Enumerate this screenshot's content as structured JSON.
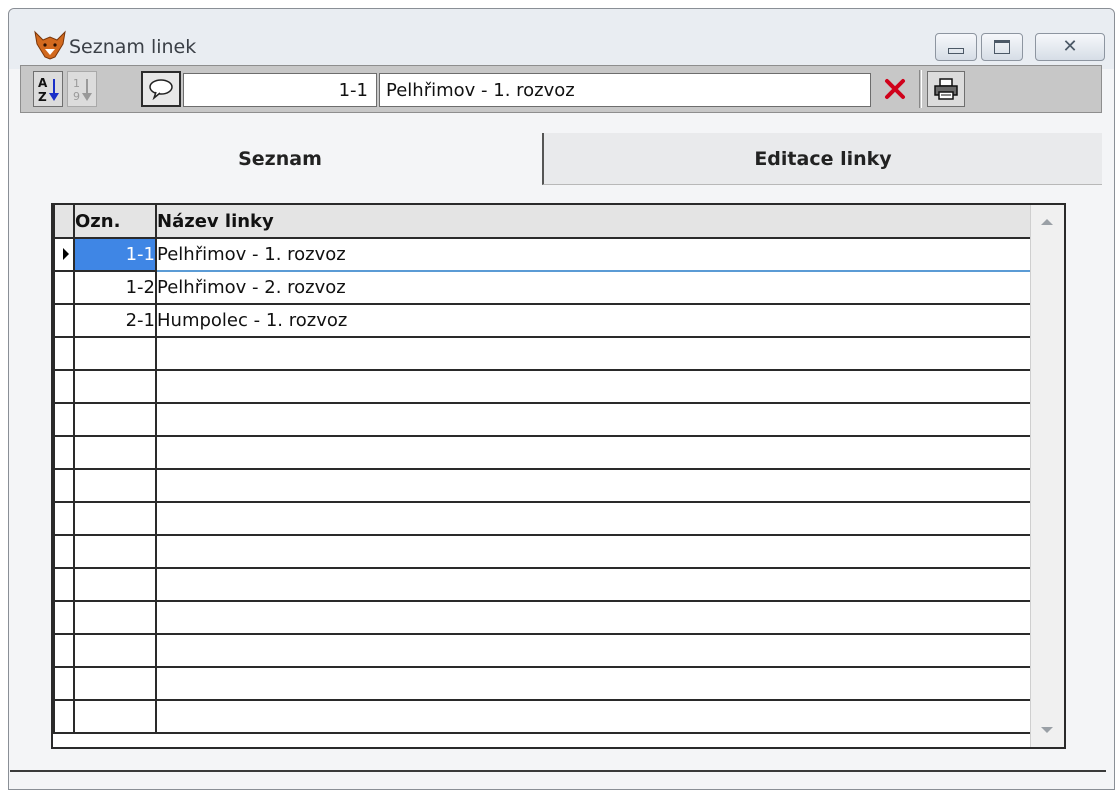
{
  "window": {
    "title": "Seznam linek",
    "controls": {
      "minimize": "minimize",
      "maximize": "maximize",
      "close": "close"
    }
  },
  "toolbar": {
    "sort_alpha_icon": "sort-az-icon",
    "sort_numeric_icon": "sort-19-icon",
    "comment_icon": "speech-bubble-icon",
    "code_value": "1-1",
    "name_value": "Pelhřimov - 1. rozvoz",
    "delete_icon": "red-x-icon",
    "print_icon": "printer-icon"
  },
  "tabs": [
    {
      "label": "Seznam",
      "active": true
    },
    {
      "label": "Editace linky",
      "active": false
    }
  ],
  "grid": {
    "columns": [
      "Ozn.",
      "Název linky"
    ],
    "rows": [
      {
        "code": "1-1",
        "name": "Pelhřimov - 1. rozvoz",
        "selected": true
      },
      {
        "code": "1-2",
        "name": "Pelhřimov - 2. rozvoz",
        "selected": false
      },
      {
        "code": "2-1",
        "name": "Humpolec - 1. rozvoz",
        "selected": false
      }
    ],
    "empty_rows": 12
  },
  "colors": {
    "selection": "#3f86e5",
    "delete_x": "#d0021b",
    "toolbar_bg": "#c7c7c7"
  }
}
